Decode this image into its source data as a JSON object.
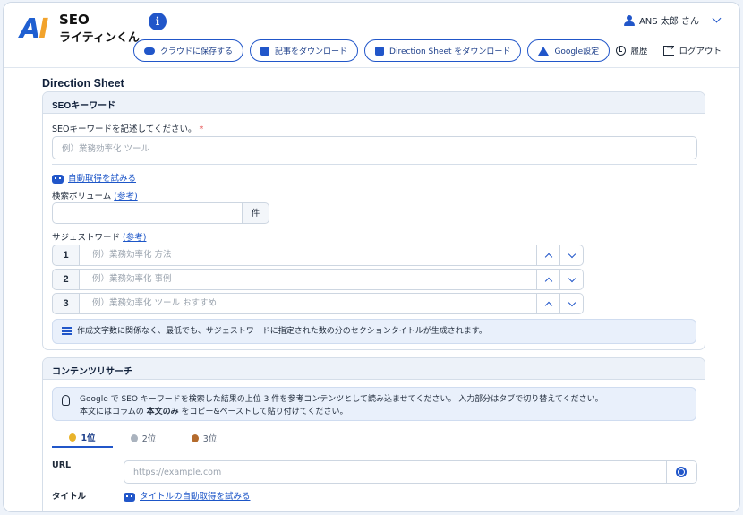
{
  "header": {
    "logo_mark": "AI",
    "logo_line1": "SEO",
    "logo_line2": "ライティンくん",
    "user_name": "ANS 太郎 さん",
    "toolbar": [
      {
        "label": "クラウドに保存する",
        "icon": "cloud-upload-icon"
      },
      {
        "label": "記事をダウンロード",
        "icon": "file-download-icon"
      },
      {
        "label": "Direction Sheet をダウンロード",
        "icon": "file-download-icon"
      },
      {
        "label": "Google設定",
        "icon": "google-drive-icon"
      }
    ],
    "history_label": "履歴",
    "logout_label": "ログアウト"
  },
  "page_title": "Direction Sheet",
  "seo_section": {
    "title": "SEOキーワード",
    "keyword_label": "SEOキーワードを記述してください。",
    "required_mark": "*",
    "keyword_placeholder": "例）業務効率化 ツール",
    "auto_fetch": "自動取得を試みる",
    "volume_label": "検索ボリューム",
    "volume_ref": "(参考)",
    "volume_unit": "件",
    "suggest_label": "サジェストワード",
    "suggest_ref": "(参考)",
    "suggest_rows": [
      {
        "num": "1",
        "placeholder": "例）業務効率化 方法"
      },
      {
        "num": "2",
        "placeholder": "例）業務効率化 事例"
      },
      {
        "num": "3",
        "placeholder": "例）業務効率化 ツール おすすめ"
      }
    ],
    "notice": "作成文字数に関係なく、最低でも、サジェストワードに指定された数の分のセクションタイトルが生成されます。"
  },
  "research_section": {
    "title": "コンテンツリサーチ",
    "info_line1": "Google で SEO キーワードを検索した結果の上位 3 件を参考コンテンツとして読み込ませてください。 入力部分はタブで切り替えてください。",
    "info_line2_pre": "本文にはコラムの ",
    "info_line2_bold": "本文のみ",
    "info_line2_post": " をコピー&ペーストして貼り付けてください。",
    "tabs": [
      {
        "label": "1位",
        "medal": "gold"
      },
      {
        "label": "2位",
        "medal": "silver"
      },
      {
        "label": "3位",
        "medal": "bronze"
      }
    ],
    "url_label": "URL",
    "url_placeholder": "https://example.com",
    "title_label": "タイトル",
    "title_auto_fetch": "タイトルの自動取得を試みる"
  }
}
